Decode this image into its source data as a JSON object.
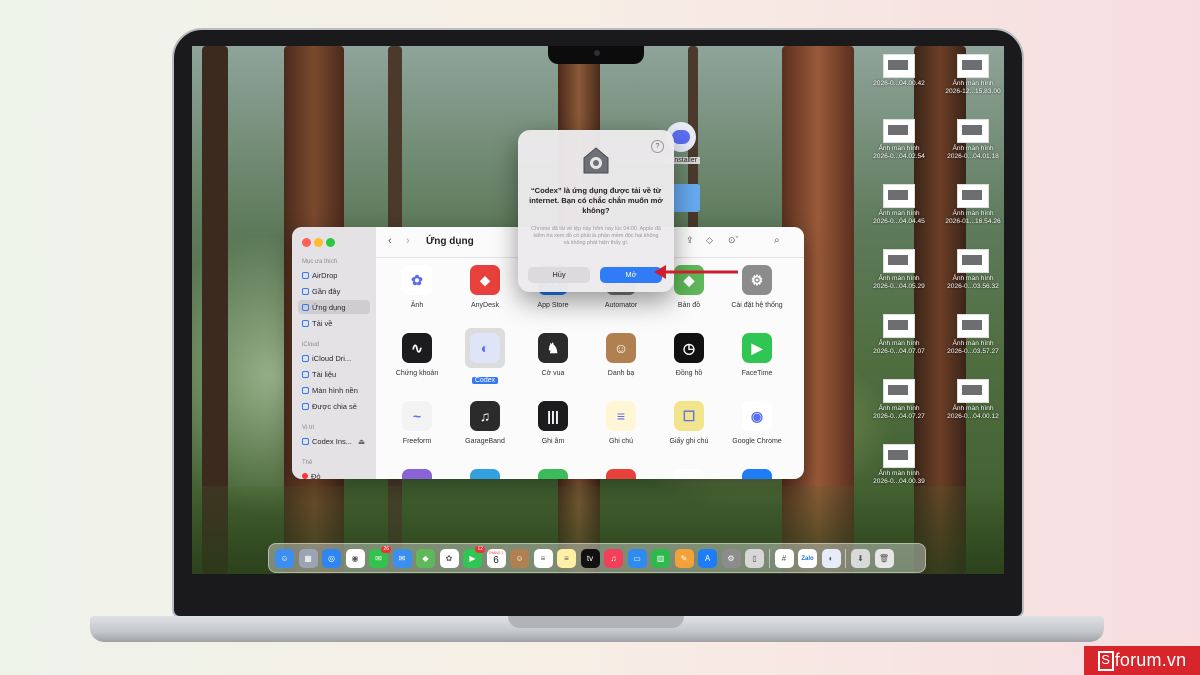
{
  "finder": {
    "title": "Ứng dụng",
    "sidebar": {
      "favorites_heading": "Mục ưa thích",
      "icloud_heading": "iCloud",
      "locations_heading": "Vị trí",
      "tags_heading": "Thẻ",
      "items": [
        "AirDrop",
        "Gần đây",
        "Ứng dụng",
        "Tải về",
        "iCloud Dri...",
        "Tài liệu",
        "Màn hình nền",
        "Được chia sẻ",
        "Codex Ins...",
        "Đỏ"
      ]
    },
    "apps_row1": [
      "Ảnh",
      "AnyDesk",
      "App Store",
      "Automator",
      "Bản đồ",
      "Cài đặt hệ thống"
    ],
    "apps_row2": [
      "Chứng khoán",
      "Codex",
      "Cờ vua",
      "Danh bạ",
      "Đồng hồ",
      "FaceTime"
    ],
    "apps_row3": [
      "Freeform",
      "GarageBand",
      "Ghi âm",
      "Ghi chú",
      "Giấy ghi chú",
      "Google Chrome"
    ]
  },
  "dialog": {
    "help": "?",
    "title": "“Codex” là ứng dụng được tải về từ internet. Bạn có chắc chắn muốn mở không?",
    "body": "Chrome đã tải về tệp này hôm nay lúc 04:00. Apple đã kiểm tra xem đồ có phải là phần mềm độc hại không và không phát hiện thấy gì.",
    "cancel_label": "Hủy",
    "open_label": "Mở"
  },
  "desktop": {
    "installer_label": "x Installer",
    "icons": [
      {
        "line1": "",
        "line2": "2026-0...04.00.42"
      },
      {
        "line1": "Ảnh màn hình",
        "line2": "2026-12...15.83.00"
      },
      {
        "line1": "Ảnh màn hình",
        "line2": "2026-0...04.02.54"
      },
      {
        "line1": "Ảnh màn hình",
        "line2": "2026-0...04.01.18"
      },
      {
        "line1": "Ảnh màn hình",
        "line2": "2026-0...04.04.45"
      },
      {
        "line1": "Ảnh màn hình",
        "line2": "2026-01...16.54.26"
      },
      {
        "line1": "Ảnh màn hình",
        "line2": "2026-0...04.05.29"
      },
      {
        "line1": "Ảnh màn hình",
        "line2": "2026-0...03.56.32"
      },
      {
        "line1": "Ảnh màn hình",
        "line2": "2026-0...04.07.07"
      },
      {
        "line1": "Ảnh màn hình",
        "line2": "2026-0...03.57.27"
      },
      {
        "line1": "Ảnh màn hình",
        "line2": "2026-0...04.07.27"
      },
      {
        "line1": "Ảnh màn hình",
        "line2": "2026-0...04.00.12"
      },
      {
        "line1": "Ảnh màn hình",
        "line2": "2026-0...04.00.39"
      }
    ]
  },
  "dock": {
    "calendar_day": "6",
    "calendar_month": "THÁNG 1",
    "zalo_label": "Zalo",
    "messages_badge": "26",
    "facetime_badge": "12"
  },
  "watermark": {
    "s": "S",
    "text": "forum.vn"
  }
}
